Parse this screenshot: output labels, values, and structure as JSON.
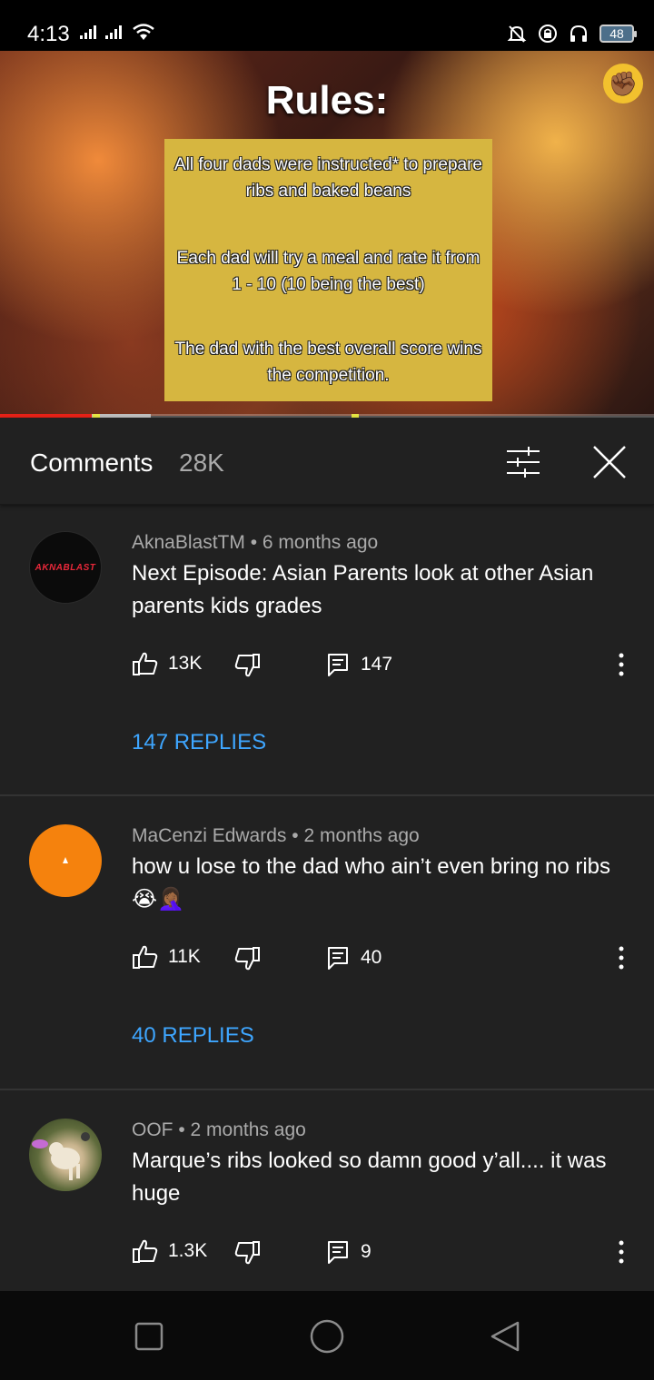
{
  "status_bar": {
    "time": "4:13",
    "battery": "48"
  },
  "video": {
    "title": "Rules:",
    "rules": [
      "All four dads were instructed* to prepare ribs and baked beans",
      "Each dad will try a meal and rate it from 1 - 10 (10 being the best)",
      "The dad with the best overall score wins the competition."
    ],
    "progress": 0.14,
    "buffered_end": 0.23,
    "badge_emoji": "✊🏾"
  },
  "comments_header": {
    "title": "Comments",
    "count": "28K"
  },
  "comments": [
    {
      "author": "AknaBlastTM",
      "sep": "•",
      "time": "6 months ago",
      "text": "Next Episode: Asian Parents look at other Asian parents kids grades",
      "likes": "13K",
      "reply_count": "147",
      "replies_label": "147 REPLIES",
      "avatar_text": "AKNABLAST"
    },
    {
      "author": "MaCenzi Edwards",
      "sep": "•",
      "time": "2 months ago",
      "text": "how u lose to the dad who ain’t even bring no ribs 😭🤦🏾‍♀️",
      "likes": "11K",
      "reply_count": "40",
      "replies_label": "40 REPLIES"
    },
    {
      "author": "OOF",
      "sep": "•",
      "time": "2 months ago",
      "text": "Marque’s ribs looked so damn good y’all.... it was huge",
      "likes": "1.3K",
      "reply_count": "9"
    }
  ],
  "icons": {
    "like": "thumb-up-icon",
    "dislike": "thumb-down-icon",
    "reply": "comment-icon",
    "more": "more-vert-icon",
    "filter": "tune-icon",
    "close": "close-icon"
  },
  "colors": {
    "background": "#212121",
    "link": "#3ea6ff",
    "progress": "#e62117",
    "rules_box": "#d6b640"
  }
}
